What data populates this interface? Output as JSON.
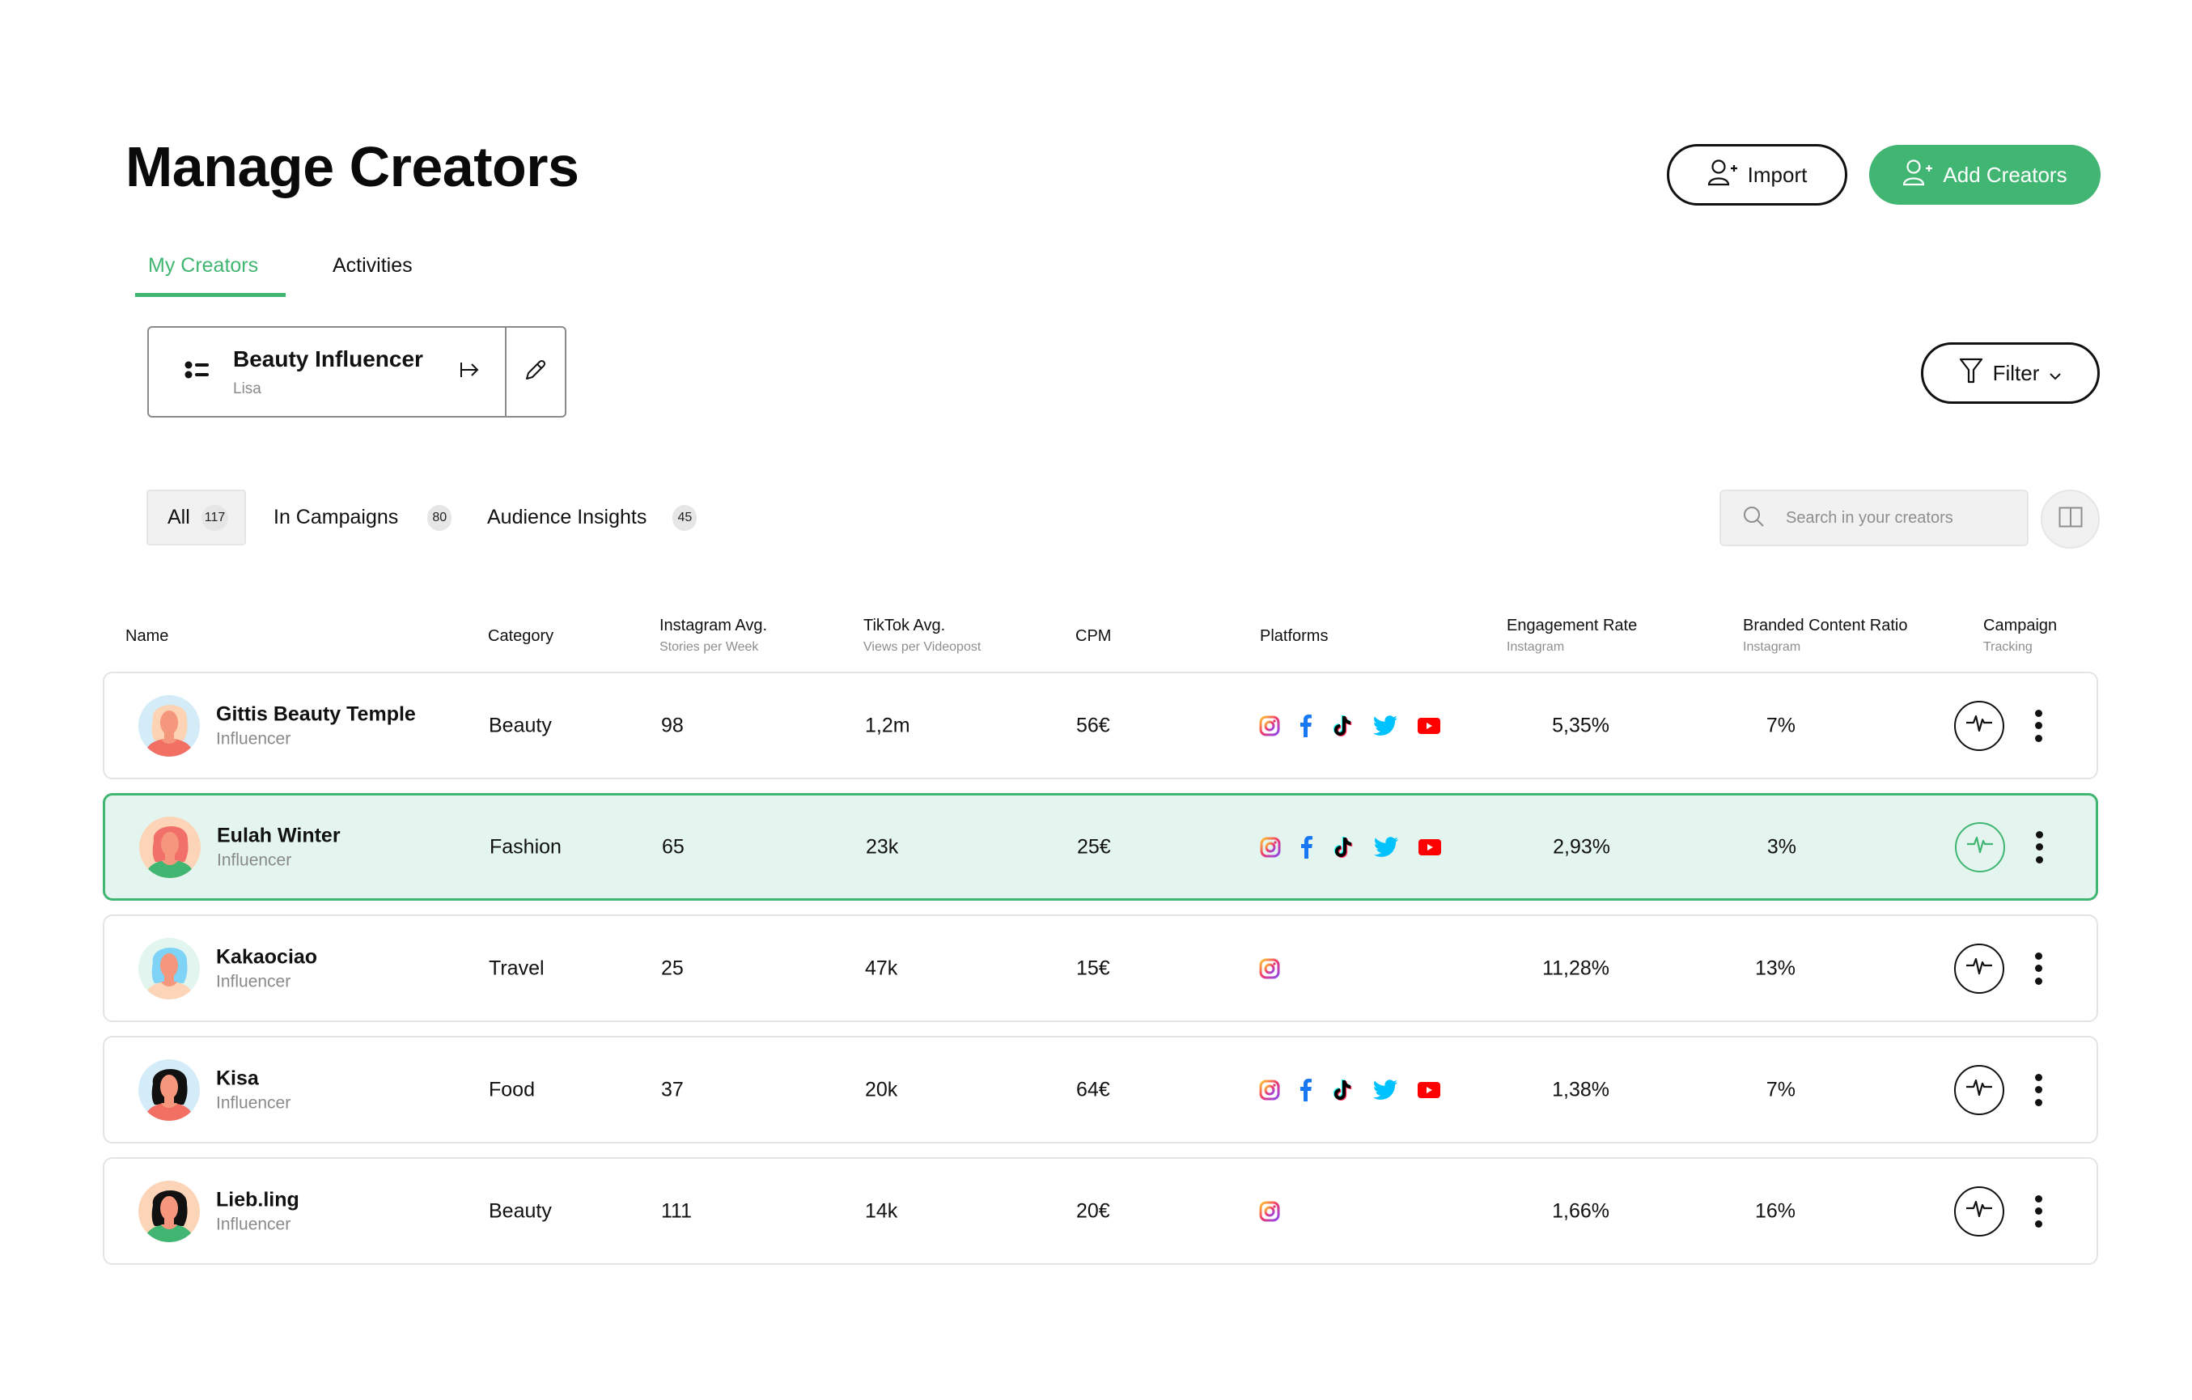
{
  "header": {
    "title": "Manage Creators",
    "import_label": "Import",
    "add_label": "Add Creators"
  },
  "tabs": [
    {
      "label": "My Creators",
      "active": true
    },
    {
      "label": "Activities",
      "active": false
    }
  ],
  "list_card": {
    "title": "Beauty Influencer",
    "owner": "Lisa"
  },
  "filter": {
    "label": "Filter"
  },
  "segments": [
    {
      "label": "All",
      "count": "117",
      "active": true
    },
    {
      "label": "In Campaigns",
      "count": "80",
      "active": false
    },
    {
      "label": "Audience Insights",
      "count": "45",
      "active": false
    }
  ],
  "search": {
    "placeholder": "Search in your creators",
    "value": ""
  },
  "colors": {
    "accent": "#40b672",
    "selected_row_bg": "#e4f5ef",
    "instagram": "#e1306c",
    "facebook": "#1877f2",
    "tiktok": "#000000",
    "twitter": "#00c2ff",
    "youtube": "#ff0000"
  },
  "table": {
    "columns": [
      {
        "label": "Name",
        "sub": ""
      },
      {
        "label": "Category",
        "sub": ""
      },
      {
        "label": "Instagram Avg.",
        "sub": "Stories per Week"
      },
      {
        "label": "TikTok Avg.",
        "sub": "Views per Videopost"
      },
      {
        "label": "CPM",
        "sub": ""
      },
      {
        "label": "Platforms",
        "sub": ""
      },
      {
        "label": "Engagement Rate",
        "sub": "Instagram"
      },
      {
        "label": "Branded Content Ratio",
        "sub": "Instagram"
      },
      {
        "label": "Campaign",
        "sub": "Tracking"
      }
    ],
    "rows": [
      {
        "name": "Gittis Beauty Temple",
        "role": "Influencer",
        "category": "Beauty",
        "ig_avg": "98",
        "tiktok_avg": "1,2m",
        "cpm": "56€",
        "platforms": [
          "instagram",
          "facebook",
          "tiktok",
          "twitter",
          "youtube"
        ],
        "engagement": "5,35%",
        "branded": "7%",
        "selected": false,
        "avatar": {
          "bg": "#d3ecf8",
          "hair": "#fcd3b5",
          "shirt": "#f26f63"
        }
      },
      {
        "name": "Eulah Winter",
        "role": "Influencer",
        "category": "Fashion",
        "ig_avg": "65",
        "tiktok_avg": "23k",
        "cpm": "25€",
        "platforms": [
          "instagram",
          "facebook",
          "tiktok",
          "twitter",
          "youtube"
        ],
        "engagement": "2,93%",
        "branded": "3%",
        "selected": true,
        "avatar": {
          "bg": "#fcd5b8",
          "hair": "#f2706a",
          "shirt": "#40b672"
        }
      },
      {
        "name": "Kakaociao",
        "role": "Influencer",
        "category": "Travel",
        "ig_avg": "25",
        "tiktok_avg": "47k",
        "cpm": "15€",
        "platforms": [
          "instagram"
        ],
        "engagement": "11,28%",
        "branded": "13%",
        "selected": false,
        "avatar": {
          "bg": "#e3f5ef",
          "hair": "#7fd3f6",
          "shirt": "#fcd5b8"
        }
      },
      {
        "name": "Kisa",
        "role": "Influencer",
        "category": "Food",
        "ig_avg": "37",
        "tiktok_avg": "20k",
        "cpm": "64€",
        "platforms": [
          "instagram",
          "facebook",
          "tiktok",
          "twitter",
          "youtube"
        ],
        "engagement": "1,38%",
        "branded": "7%",
        "selected": false,
        "avatar": {
          "bg": "#d3ecf8",
          "hair": "#111111",
          "shirt": "#f26f63"
        }
      },
      {
        "name": "Lieb.ling",
        "role": "Influencer",
        "category": "Beauty",
        "ig_avg": "111",
        "tiktok_avg": "14k",
        "cpm": "20€",
        "platforms": [
          "instagram"
        ],
        "engagement": "1,66%",
        "branded": "16%",
        "selected": false,
        "avatar": {
          "bg": "#fcd5b8",
          "hair": "#111111",
          "shirt": "#40b672"
        }
      }
    ]
  }
}
